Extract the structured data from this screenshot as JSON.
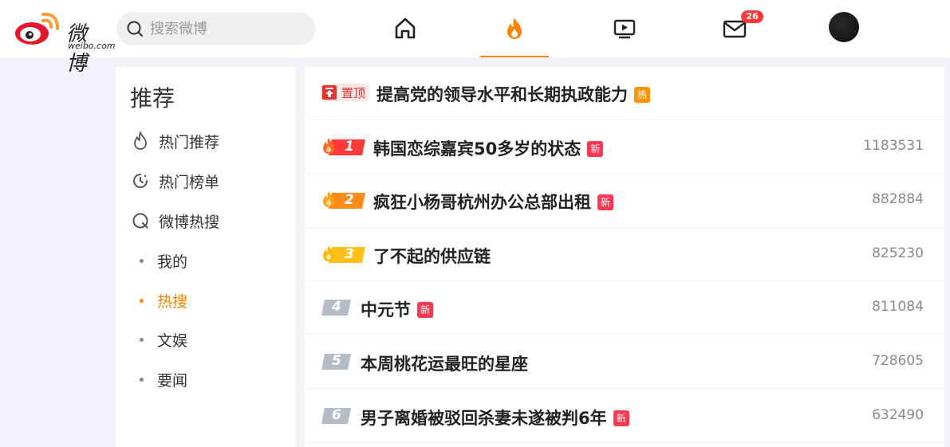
{
  "header": {
    "logo": {
      "text": "微博",
      "sub": "weibo.com"
    },
    "search": {
      "placeholder": "搜索微博"
    },
    "nav": {
      "home_icon": "home-icon",
      "hot_icon": "fire-icon",
      "video_icon": "video-icon",
      "message_icon": "mail-icon",
      "message_badge": "26"
    },
    "avatar": "avatar"
  },
  "sidebar": {
    "title": "推荐",
    "items": [
      {
        "label": "热门推荐",
        "icon": "flame-outline-icon"
      },
      {
        "label": "热门榜单",
        "icon": "clock-icon"
      },
      {
        "label": "微博热搜",
        "icon": "search-circle-icon"
      }
    ],
    "subitems": [
      {
        "label": "我的",
        "active": false
      },
      {
        "label": "热搜",
        "active": true
      },
      {
        "label": "文娱",
        "active": false
      },
      {
        "label": "要闻",
        "active": false
      }
    ],
    "accent": "#ff8200"
  },
  "hotlist": {
    "pinned": {
      "pin_label": "置顶",
      "title": "提高党的领导水平和长期执政能力",
      "tag": "热"
    },
    "rows": [
      {
        "rank": "1",
        "title": "韩国恋综嘉宾50多岁的状态",
        "tag": "新",
        "count": "1183531"
      },
      {
        "rank": "2",
        "title": "疯狂小杨哥杭州办公总部出租",
        "tag": "新",
        "count": "882884"
      },
      {
        "rank": "3",
        "title": "了不起的供应链",
        "tag": "",
        "count": "825230"
      },
      {
        "rank": "4",
        "title": "中元节",
        "tag": "新",
        "count": "811084"
      },
      {
        "rank": "5",
        "title": "本周桃花运最旺的星座",
        "tag": "",
        "count": "728605"
      },
      {
        "rank": "6",
        "title": "男子离婚被驳回杀妻未遂被判6年",
        "tag": "新",
        "count": "632490"
      }
    ]
  }
}
